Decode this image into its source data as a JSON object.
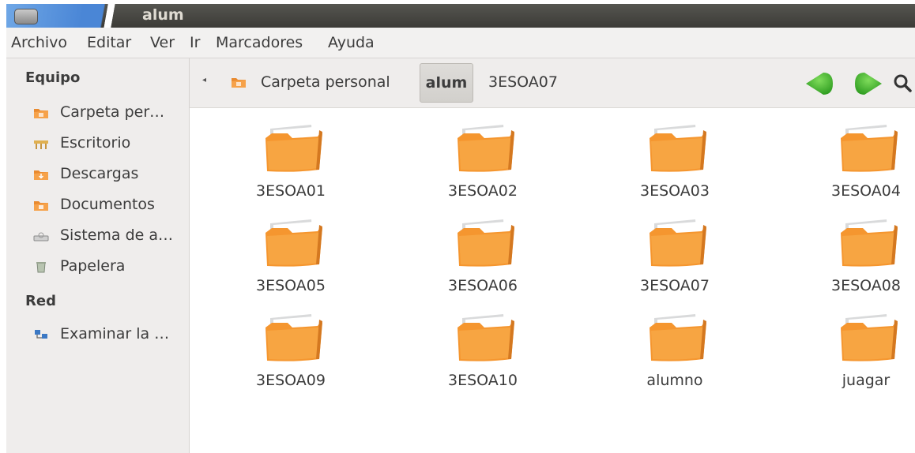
{
  "window": {
    "title": "alum"
  },
  "menubar": [
    "Archivo",
    "Editar",
    "Ver",
    "Ir",
    "Marcadores",
    "Ayuda"
  ],
  "sidebar": {
    "sections": [
      {
        "heading": "Equipo",
        "items": [
          {
            "label": "Carpeta per…",
            "icon": "home-folder-icon"
          },
          {
            "label": "Escritorio",
            "icon": "desktop-icon"
          },
          {
            "label": "Descargas",
            "icon": "downloads-folder-icon"
          },
          {
            "label": "Documentos",
            "icon": "documents-folder-icon"
          },
          {
            "label": "Sistema de a…",
            "icon": "filesystem-drive-icon"
          },
          {
            "label": "Papelera",
            "icon": "trash-icon"
          }
        ]
      },
      {
        "heading": "Red",
        "items": [
          {
            "label": "Examinar la …",
            "icon": "network-icon"
          }
        ]
      }
    ]
  },
  "pathbar": {
    "crumbs": [
      "Carpeta personal",
      "alum",
      "3ESOA07"
    ],
    "active": "alum"
  },
  "folders": [
    "3ESOA01",
    "3ESOA02",
    "3ESOA03",
    "3ESOA04",
    "3ESOA05",
    "3ESOA06",
    "3ESOA07",
    "3ESOA08",
    "3ESOA09",
    "3ESOA10",
    "alumno",
    "juagar"
  ],
  "colors": {
    "folder": "#f5962f",
    "nav_arrow": "#3caa26",
    "title_bar": "#3c3b37"
  }
}
